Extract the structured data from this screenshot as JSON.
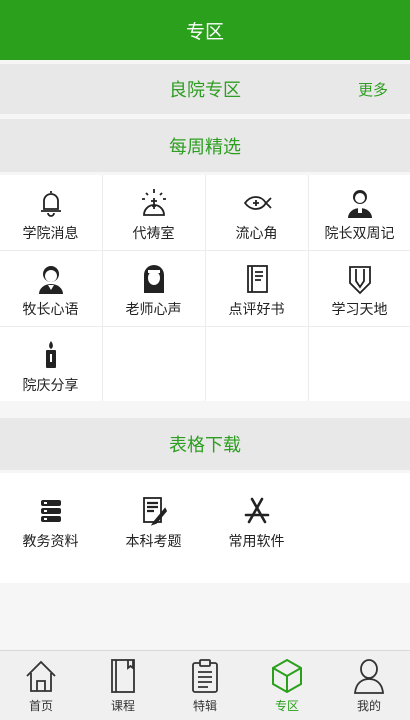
{
  "header": {
    "title": "专区"
  },
  "featured_section": {
    "title": "良院专区",
    "more_label": "更多"
  },
  "weekly": {
    "title": "每周精选",
    "items": [
      {
        "label": "学院消息",
        "icon": "bell-icon"
      },
      {
        "label": "代祷室",
        "icon": "cross-light-icon"
      },
      {
        "label": "流心角",
        "icon": "fish-icon"
      },
      {
        "label": "院长双周记",
        "icon": "person-collar-icon"
      },
      {
        "label": "牧长心语",
        "icon": "person-icon"
      },
      {
        "label": "老师心声",
        "icon": "nun-icon"
      },
      {
        "label": "点评好书",
        "icon": "book-icon"
      },
      {
        "label": "学习天地",
        "icon": "pencil-shield-icon"
      },
      {
        "label": "院庆分享",
        "icon": "candle-icon"
      }
    ]
  },
  "downloads": {
    "title": "表格下载",
    "items": [
      {
        "label": "教务资料",
        "icon": "database-icon"
      },
      {
        "label": "本科考题",
        "icon": "exam-icon"
      },
      {
        "label": "常用软件",
        "icon": "app-store-icon"
      }
    ]
  },
  "tabbar": {
    "active_color": "#2aa01c",
    "items": [
      {
        "label": "首页",
        "icon": "home-icon"
      },
      {
        "label": "课程",
        "icon": "notebook-icon"
      },
      {
        "label": "特辑",
        "icon": "clipboard-icon"
      },
      {
        "label": "专区",
        "icon": "cube-icon",
        "active": true
      },
      {
        "label": "我的",
        "icon": "user-icon"
      }
    ]
  }
}
